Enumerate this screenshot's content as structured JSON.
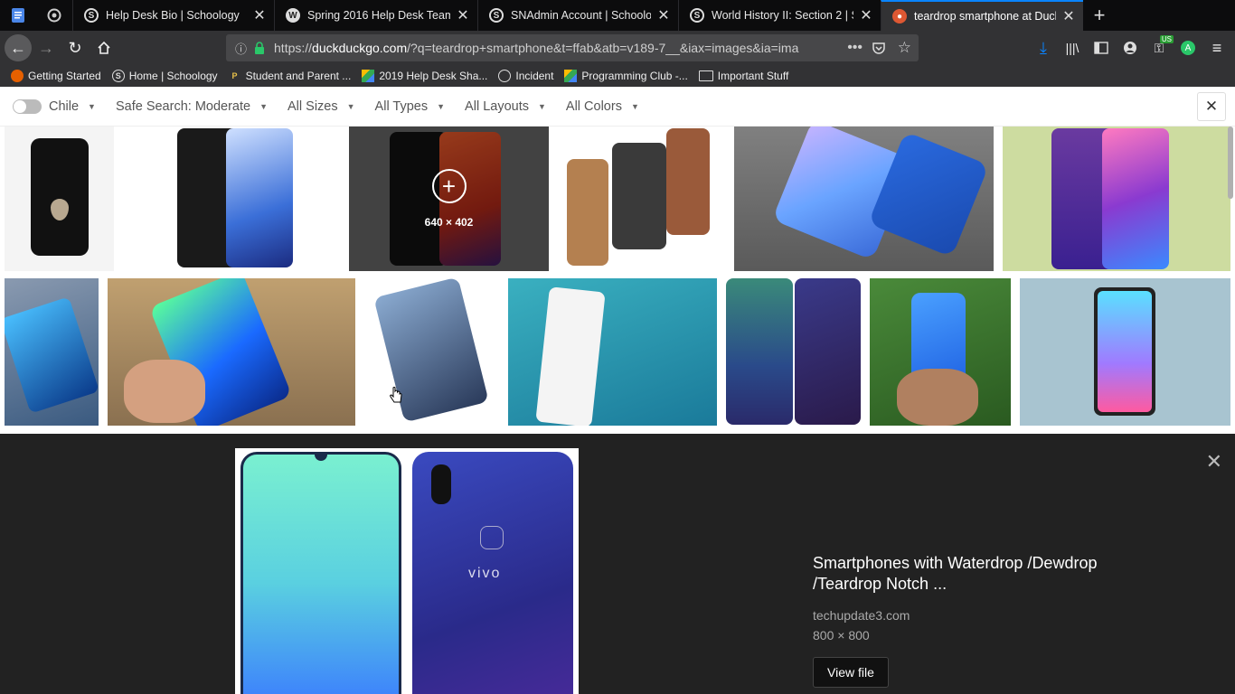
{
  "tabs": [
    {
      "title": "Help Desk Bio | Schoology",
      "icon": "schoology-icon",
      "color": "#3f7fe0"
    },
    {
      "title": "Spring 2016 Help Desk Team – H",
      "icon": "wordpress-icon",
      "color": "#3f7fe0"
    },
    {
      "title": "SNAdmin Account | Schoology",
      "icon": "schoology-icon",
      "color": "#3f7fe0"
    },
    {
      "title": "World History II: Section 2 | Sch",
      "icon": "schoology-icon",
      "color": "#3f7fe0"
    },
    {
      "title": "teardrop smartphone at DuckDu",
      "icon": "duckduckgo-icon",
      "color": "#de5833"
    }
  ],
  "url": {
    "prefix": "https://",
    "domain": "duckduckgo.com",
    "path": "/?q=teardrop+smartphone&t=ffab&atb=v189-7__&iax=images&ia=ima"
  },
  "bookmarks": [
    "Getting Started",
    "Home | Schoology",
    "Student and Parent ...",
    "2019 Help Desk Sha...",
    "Incident",
    "Programming Club -...",
    "Important Stuff"
  ],
  "filters": {
    "region": "Chile",
    "safe_search": "Safe Search: Moderate",
    "sizes": "All Sizes",
    "types": "All Types",
    "layouts": "All Layouts",
    "colors": "All Colors"
  },
  "hover_dims": "640 × 402",
  "detail": {
    "title": "Smartphones with Waterdrop /Dewdrop /Teardrop Notch ...",
    "source": "techupdate3.com",
    "size": "800 × 800",
    "view_file": "View file"
  },
  "accent_color": "#0a84ff"
}
